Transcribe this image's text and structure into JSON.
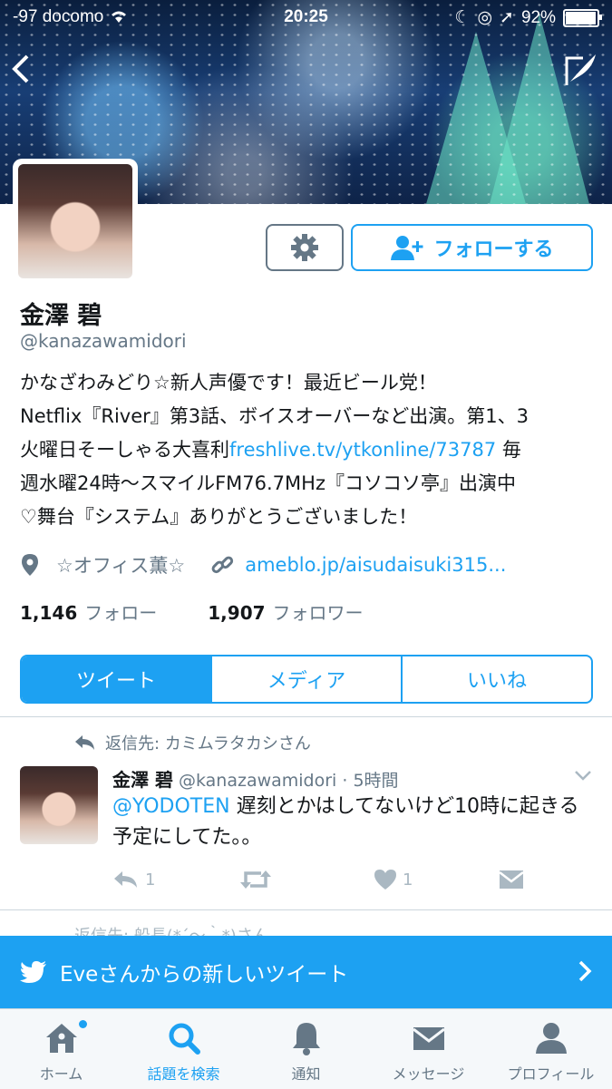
{
  "status_bar": {
    "carrier": "-97 docomo",
    "time": "20:25",
    "battery": "92%",
    "battery_level": 0.92
  },
  "profile": {
    "name": "金澤 碧",
    "handle": "@kanazawamidori",
    "bio_line1": "かなざわみどり☆新人声優です！最近ビール党！",
    "bio_line2": "Netflix『River』第3話、ボイスオーバーなど出演。第1、3",
    "bio_line3_pre": "火曜日そーしゃる大喜利",
    "bio_link": "freshlive.tv/ytkonline/73787",
    "bio_line3_post": " 毎",
    "bio_line4": "週水曜24時〜スマイルFM76.7MHz『コソコソ亭』出演中",
    "bio_line5": "♡舞台『システム』ありがとうございました！",
    "location": "☆オフィス薫☆",
    "website": "ameblo.jp/aisudaisuki315...",
    "following_count": "1,146",
    "following_label": "フォロー",
    "followers_count": "1,907",
    "followers_label": "フォロワー",
    "follow_button": "フォローする"
  },
  "tabs": [
    "ツイート",
    "メディア",
    "いいね"
  ],
  "tweet": {
    "reply_context": "返信先: カミムラタカシさん",
    "author_name": "金澤 碧",
    "author_sub": "@kanazawamidori · 5時間",
    "mention": "@YODOTEN",
    "text_rest": " 遅刻とかはしてないけど10時に起きる予定にしてた。。",
    "reply_count": "1",
    "like_count": "1"
  },
  "next_tweet_peek": "返信先: 船長(*´～｀*)さん",
  "notification": {
    "text": "Eveさんからの新しいツイート"
  },
  "tabbar": {
    "items": [
      "ホーム",
      "話題を検索",
      "通知",
      "メッセージ",
      "プロフィール"
    ],
    "active_index": 1
  },
  "colors": {
    "brand": "#1da1f2",
    "muted": "#657786",
    "text": "#14171a"
  }
}
